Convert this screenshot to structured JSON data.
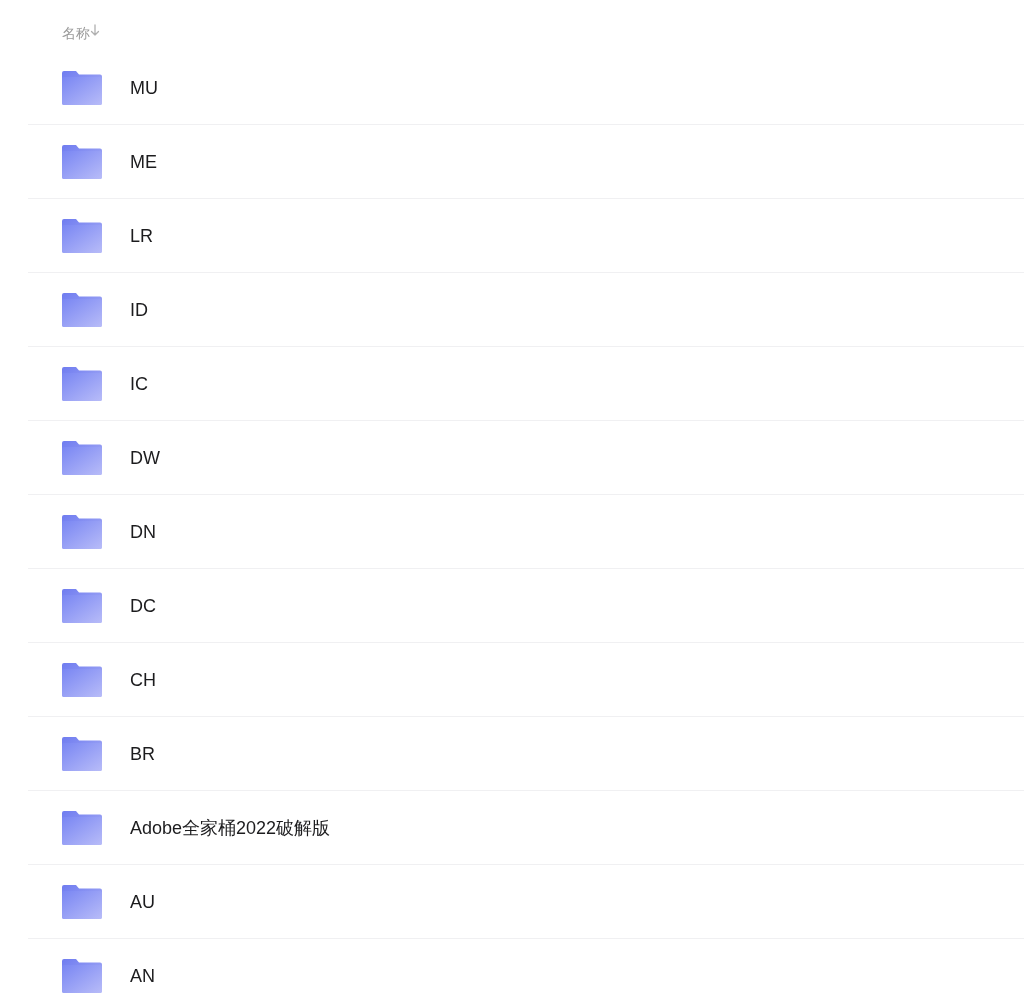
{
  "header": {
    "label": "名称",
    "sort_descending": true
  },
  "files": [
    {
      "name": "MU"
    },
    {
      "name": "ME"
    },
    {
      "name": "LR"
    },
    {
      "name": "ID"
    },
    {
      "name": "IC"
    },
    {
      "name": "DW"
    },
    {
      "name": "DN"
    },
    {
      "name": "DC"
    },
    {
      "name": "CH"
    },
    {
      "name": "BR"
    },
    {
      "name": "Adobe全家桶2022破解版"
    },
    {
      "name": "AU"
    },
    {
      "name": "AN"
    }
  ]
}
